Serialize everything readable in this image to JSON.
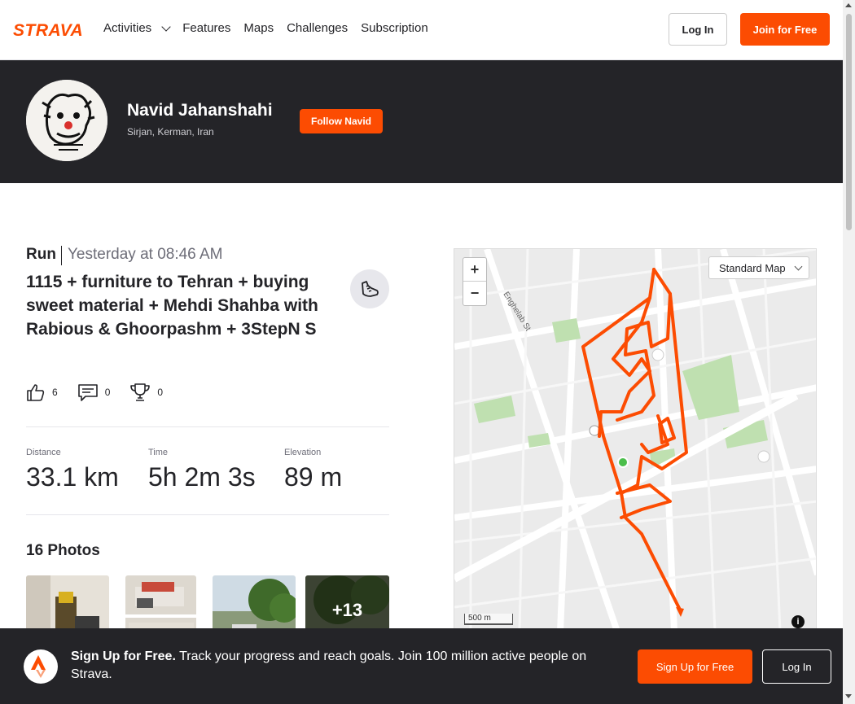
{
  "nav": {
    "logo": "STRAVA",
    "links": [
      "Activities",
      "Features",
      "Maps",
      "Challenges",
      "Subscription"
    ],
    "login_label": "Log In",
    "join_label": "Join for Free"
  },
  "athlete": {
    "name": "Navid Jahanshahi",
    "location": "Sirjan, Kerman, Iran",
    "follow_label": "Follow Navid"
  },
  "activity": {
    "type": "Run",
    "date": "Yesterday at 08:46 AM",
    "title": "1115 + furniture to Tehran + buying sweet material + Mehdi Shahba with Rabious & Ghoorpashm + 3StepN S",
    "kudos": "6",
    "comments": "0",
    "achievements": "0",
    "stats": [
      {
        "label": "Distance",
        "value": "33.1 km"
      },
      {
        "label": "Time",
        "value": "5h 2m 3s"
      },
      {
        "label": "Elevation",
        "value": "89 m"
      }
    ],
    "photos_title": "16 Photos",
    "photos_more": "+13"
  },
  "map": {
    "zoom_in": "+",
    "zoom_out": "−",
    "style_label": "Standard Map",
    "scale_label": "500 m",
    "info": "i",
    "route_color": "#fc4c02",
    "street_labels": [
      "Enghelab St"
    ]
  },
  "banner": {
    "headline": "Sign Up for Free.",
    "text": "Track your progress and reach goals. Join 100 million active people on Strava.",
    "signup_label": "Sign Up for Free",
    "login_label": "Log In"
  },
  "colors": {
    "brand": "#fc4c02",
    "dark": "#242428"
  }
}
